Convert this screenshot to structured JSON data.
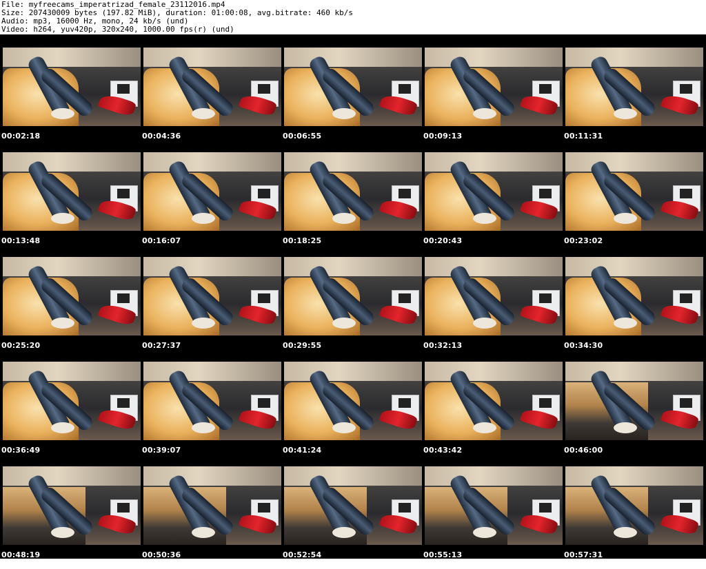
{
  "header": {
    "file_line": "File: myfreecams_imperatrizad_female_23112016.mp4",
    "size_line": "Size: 207430009 bytes (197.82 MiB), duration: 01:00:08, avg.bitrate: 460 kb/s",
    "audio_line": "Audio: mp3, 16000 Hz, mono, 24 kb/s (und)",
    "video_line": "Video: h264, yuv420p, 320x240, 1000.00 fps(r) (und)"
  },
  "thumbnails": [
    {
      "timestamp": "00:02:18",
      "scene": "armchair"
    },
    {
      "timestamp": "00:04:36",
      "scene": "armchair"
    },
    {
      "timestamp": "00:06:55",
      "scene": "armchair"
    },
    {
      "timestamp": "00:09:13",
      "scene": "armchair"
    },
    {
      "timestamp": "00:11:31",
      "scene": "armchair"
    },
    {
      "timestamp": "00:13:48",
      "scene": "armchair"
    },
    {
      "timestamp": "00:16:07",
      "scene": "armchair"
    },
    {
      "timestamp": "00:18:25",
      "scene": "armchair"
    },
    {
      "timestamp": "00:20:43",
      "scene": "armchair"
    },
    {
      "timestamp": "00:23:02",
      "scene": "armchair"
    },
    {
      "timestamp": "00:25:20",
      "scene": "armchair"
    },
    {
      "timestamp": "00:27:37",
      "scene": "armchair"
    },
    {
      "timestamp": "00:29:55",
      "scene": "armchair"
    },
    {
      "timestamp": "00:32:13",
      "scene": "armchair"
    },
    {
      "timestamp": "00:34:30",
      "scene": "armchair"
    },
    {
      "timestamp": "00:36:49",
      "scene": "armchair"
    },
    {
      "timestamp": "00:39:07",
      "scene": "armchair"
    },
    {
      "timestamp": "00:41:24",
      "scene": "armchair"
    },
    {
      "timestamp": "00:43:42",
      "scene": "armchair"
    },
    {
      "timestamp": "00:46:00",
      "scene": "underside"
    },
    {
      "timestamp": "00:48:19",
      "scene": "underside"
    },
    {
      "timestamp": "00:50:36",
      "scene": "underside"
    },
    {
      "timestamp": "00:52:54",
      "scene": "underside"
    },
    {
      "timestamp": "00:55:13",
      "scene": "underside"
    },
    {
      "timestamp": "00:57:31",
      "scene": "underside"
    }
  ]
}
